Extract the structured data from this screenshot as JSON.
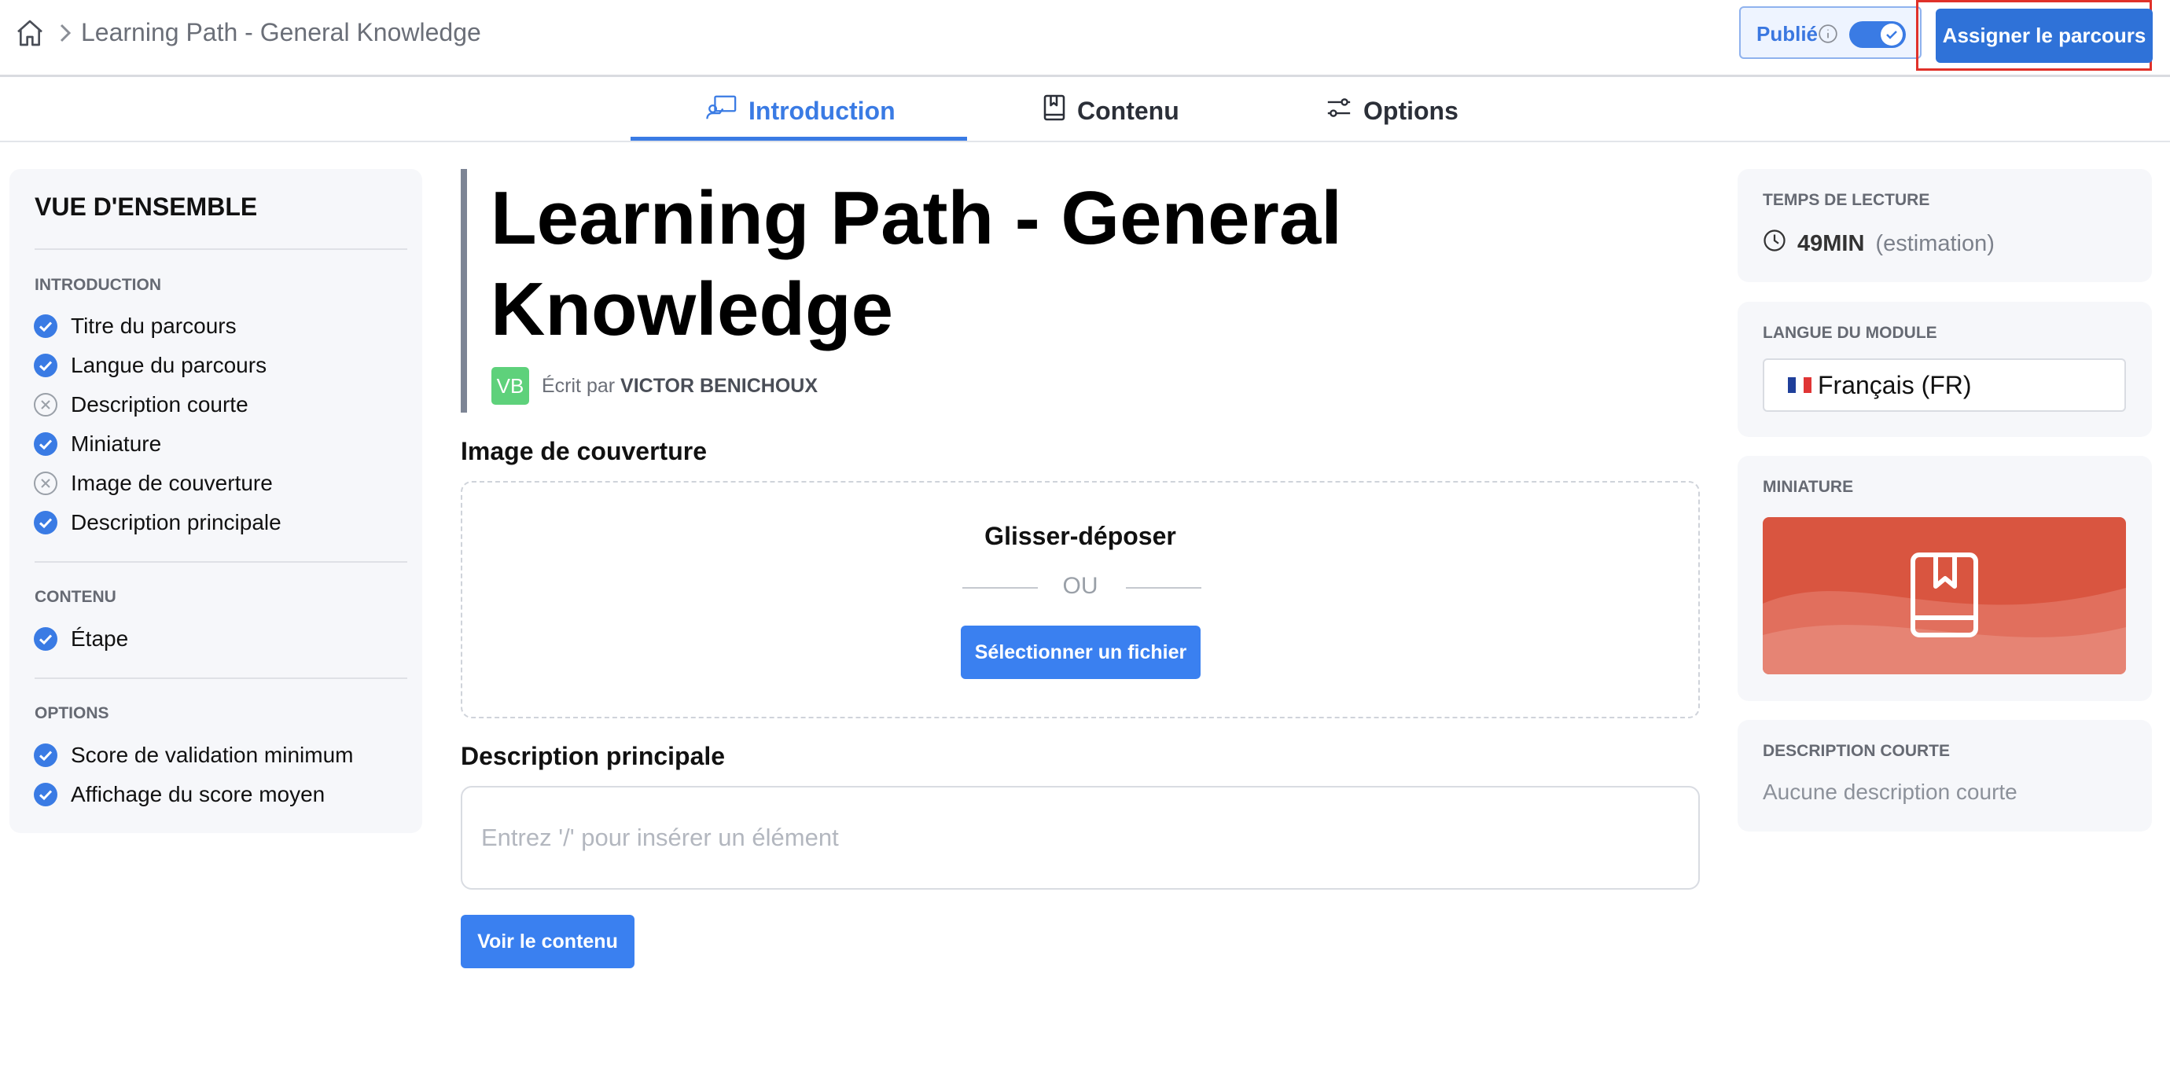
{
  "header": {
    "breadcrumb_title": "Learning Path - General Knowledge",
    "published_label": "Publié",
    "published_on": true,
    "assign_button": "Assigner le parcours",
    "accent_color": "#3a7be4",
    "highlight_color": "#e0312a"
  },
  "tabs": [
    {
      "label": "Introduction",
      "icon": "presentation-icon",
      "active": true
    },
    {
      "label": "Contenu",
      "icon": "book-icon",
      "active": false
    },
    {
      "label": "Options",
      "icon": "sliders-icon",
      "active": false
    }
  ],
  "sidebar": {
    "title": "VUE D'ENSEMBLE",
    "sections": [
      {
        "label": "INTRODUCTION",
        "items": [
          {
            "label": "Titre du parcours",
            "done": true
          },
          {
            "label": "Langue du parcours",
            "done": true
          },
          {
            "label": "Description courte",
            "done": false
          },
          {
            "label": "Miniature",
            "done": true
          },
          {
            "label": "Image de couverture",
            "done": false
          },
          {
            "label": "Description principale",
            "done": true
          }
        ]
      },
      {
        "label": "CONTENU",
        "items": [
          {
            "label": "Étape",
            "done": true
          }
        ]
      },
      {
        "label": "OPTIONS",
        "items": [
          {
            "label": "Score de validation minimum",
            "done": true
          },
          {
            "label": "Affichage du score moyen",
            "done": true
          }
        ]
      }
    ]
  },
  "main": {
    "title_line1": "Learning Path - General",
    "title_line2": "Knowledge",
    "author_initials": "VB",
    "author_prefix": "Écrit par",
    "author_name": "VICTOR BENICHOUX",
    "cover_heading": "Image de couverture",
    "dropzone_title": "Glisser-déposer",
    "dropzone_or": "OU",
    "select_file_button": "Sélectionner un fichier",
    "description_heading": "Description principale",
    "description_placeholder": "Entrez '/' pour insérer un élément",
    "view_content_button": "Voir le contenu"
  },
  "right": {
    "reading_label": "TEMPS DE LECTURE",
    "reading_value": "49MIN",
    "reading_note": "(estimation)",
    "language_label": "LANGUE DU MODULE",
    "language_value": "Français (FR)",
    "thumbnail_label": "MINIATURE",
    "thumbnail_color": "#d95540",
    "short_desc_label": "DESCRIPTION COURTE",
    "short_desc_value": "Aucune description courte"
  }
}
